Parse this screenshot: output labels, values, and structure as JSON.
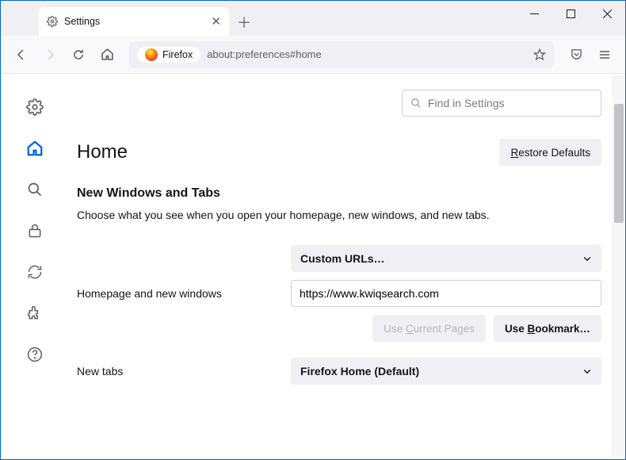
{
  "tab": {
    "title": "Settings"
  },
  "urlbar": {
    "pill": "Firefox",
    "url": "about:preferences#home"
  },
  "search": {
    "placeholder": "Find in Settings"
  },
  "page": {
    "title": "Home",
    "restore_defaults": "Restore Defaults",
    "section_title": "New Windows and Tabs",
    "section_desc": "Choose what you see when you open your homepage, new windows, and new tabs."
  },
  "homepage": {
    "dropdown": "Custom URLs…",
    "label": "Homepage and new windows",
    "value": "https://www.kwiqsearch.com",
    "use_current": "Use Current Pages",
    "use_bookmark": "Use Bookmark…"
  },
  "newtabs": {
    "label": "New tabs",
    "dropdown": "Firefox Home (Default)"
  }
}
